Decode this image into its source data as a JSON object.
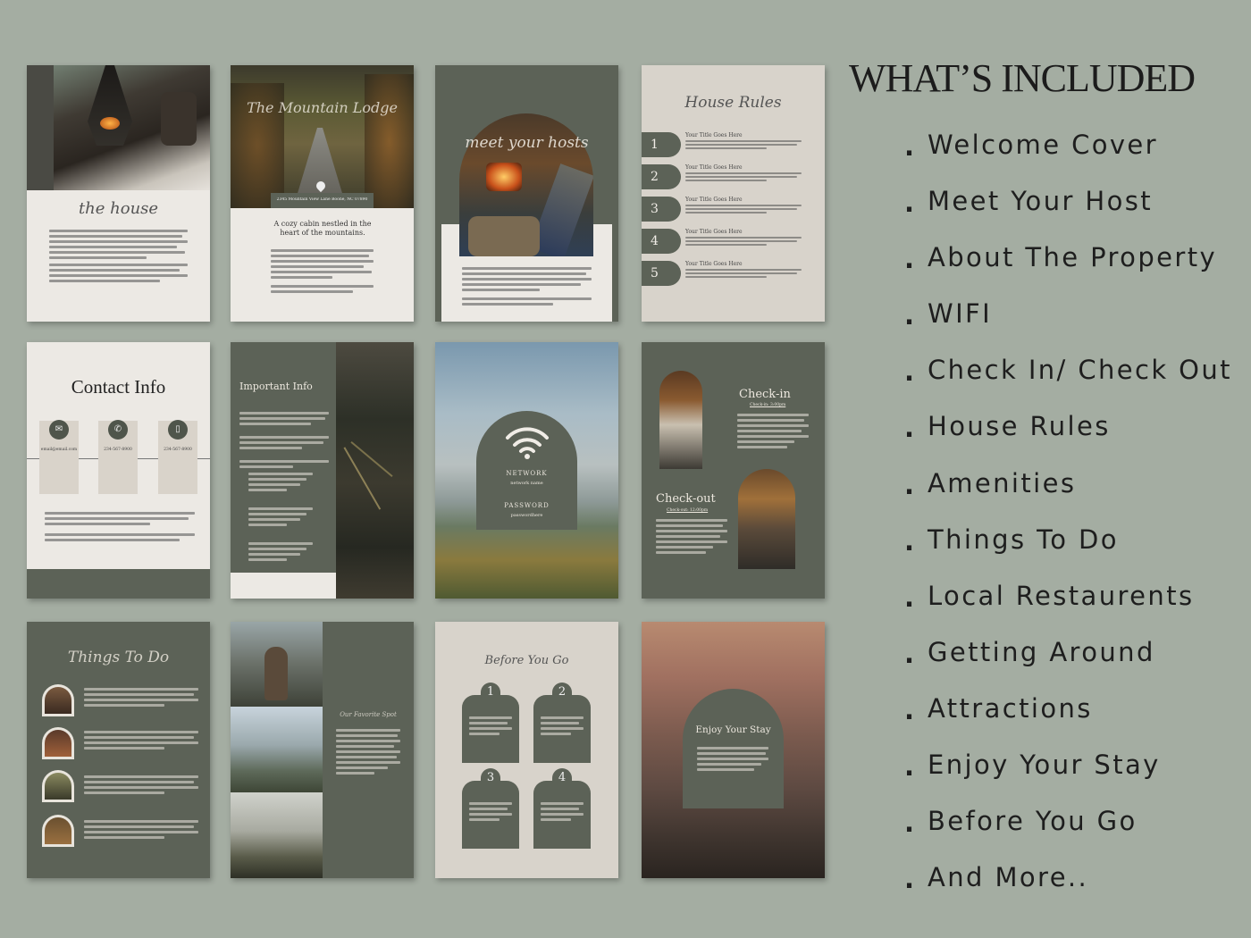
{
  "heading": "WHAT’S INCLUDED",
  "bullet": ".",
  "included": [
    "Welcome Cover",
    "Meet Your Host",
    "About The Property",
    "WIFI",
    "Check In/ Check Out",
    "House Rules",
    "Amenities",
    "Things To Do",
    "Local Restaurents",
    "Getting Around",
    "Attractions",
    "Enjoy Your Stay",
    "Before You Go",
    "And More.."
  ],
  "pages": {
    "house": {
      "title": "the house"
    },
    "lodge": {
      "title": "The Mountain Lodge",
      "address": "2345 Mountain View Lane Boone, NC 07890",
      "tagline": "A cozy cabin nestled in the heart of the mountains."
    },
    "hosts": {
      "title": "meet your hosts"
    },
    "rules": {
      "title": "House Rules",
      "items": [
        {
          "num": "1",
          "label": "Your Title Goes Here"
        },
        {
          "num": "2",
          "label": "Your Title Goes Here"
        },
        {
          "num": "3",
          "label": "Your Title Goes Here"
        },
        {
          "num": "4",
          "label": "Your Title Goes Here"
        },
        {
          "num": "5",
          "label": "Your Title Goes Here"
        }
      ]
    },
    "contact": {
      "title": "Contact Info",
      "email": "email@email.com",
      "phone": "234-567-8900",
      "mobile": "234-567-8900"
    },
    "important": {
      "title": "Important Info"
    },
    "wifi": {
      "network_label": "NETWORK",
      "network_value": "network name",
      "password_label": "PASSWORD",
      "password_value": "passwordhere"
    },
    "checkin": {
      "in_title": "Check-in",
      "in_time": "Check-in: 3:00pm",
      "out_title": "Check-out",
      "out_time": "Check-out: 12:00pm"
    },
    "things": {
      "title": "Things To Do"
    },
    "spot": {
      "title": "Our Favorite Spot"
    },
    "before": {
      "title": "Before You Go",
      "nums": [
        "1",
        "2",
        "3",
        "4"
      ]
    },
    "enjoy": {
      "title": "Enjoy Your Stay"
    }
  }
}
